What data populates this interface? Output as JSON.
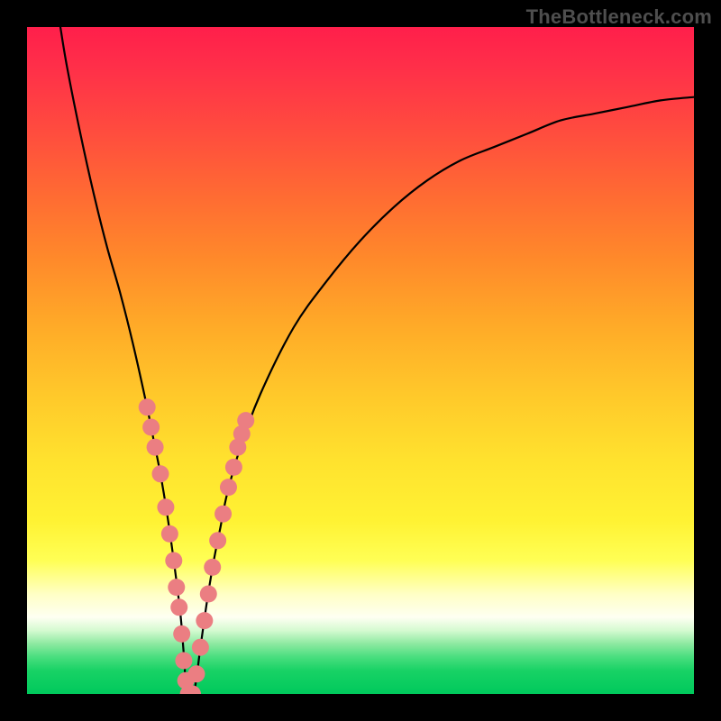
{
  "watermark": "TheBottleneck.com",
  "chart_data": {
    "type": "line",
    "title": "",
    "xlabel": "",
    "ylabel": "",
    "xlim": [
      0,
      100
    ],
    "ylim": [
      0,
      100
    ],
    "series": [
      {
        "name": "bottleneck-curve",
        "x": [
          5,
          6,
          8,
          10,
          12,
          14,
          16,
          18,
          19,
          20,
          21,
          22,
          23,
          23.5,
          24,
          25,
          26,
          27,
          28,
          29,
          30,
          32,
          35,
          40,
          45,
          50,
          55,
          60,
          65,
          70,
          75,
          80,
          85,
          90,
          95,
          100
        ],
        "values": [
          100,
          94,
          84,
          75,
          67,
          60,
          52,
          43,
          38,
          33,
          27,
          20,
          12,
          6,
          0,
          0,
          7,
          14,
          20,
          25,
          30,
          37,
          45,
          55,
          62,
          68,
          73,
          77,
          80,
          82,
          84,
          86,
          87,
          88,
          89,
          89.5
        ]
      }
    ],
    "highlight_points": {
      "name": "marked-range",
      "color": "#eb7e82",
      "points": [
        {
          "x": 18.0,
          "y": 43
        },
        {
          "x": 18.6,
          "y": 40
        },
        {
          "x": 19.2,
          "y": 37
        },
        {
          "x": 20.0,
          "y": 33
        },
        {
          "x": 20.8,
          "y": 28
        },
        {
          "x": 21.4,
          "y": 24
        },
        {
          "x": 22.0,
          "y": 20
        },
        {
          "x": 22.4,
          "y": 16
        },
        {
          "x": 22.8,
          "y": 13
        },
        {
          "x": 23.2,
          "y": 9
        },
        {
          "x": 23.5,
          "y": 5
        },
        {
          "x": 23.8,
          "y": 2
        },
        {
          "x": 24.2,
          "y": 0
        },
        {
          "x": 24.8,
          "y": 0
        },
        {
          "x": 25.4,
          "y": 3
        },
        {
          "x": 26.0,
          "y": 7
        },
        {
          "x": 26.6,
          "y": 11
        },
        {
          "x": 27.2,
          "y": 15
        },
        {
          "x": 27.8,
          "y": 19
        },
        {
          "x": 28.6,
          "y": 23
        },
        {
          "x": 29.4,
          "y": 27
        },
        {
          "x": 30.2,
          "y": 31
        },
        {
          "x": 31.0,
          "y": 34
        },
        {
          "x": 31.6,
          "y": 37
        },
        {
          "x": 32.2,
          "y": 39
        },
        {
          "x": 32.8,
          "y": 41
        }
      ]
    },
    "gradient_stops": [
      {
        "offset": 0.0,
        "color": "#ff1f4b"
      },
      {
        "offset": 0.06,
        "color": "#ff2f49"
      },
      {
        "offset": 0.15,
        "color": "#ff4a3f"
      },
      {
        "offset": 0.25,
        "color": "#ff6a33"
      },
      {
        "offset": 0.35,
        "color": "#ff8a2a"
      },
      {
        "offset": 0.45,
        "color": "#ffab28"
      },
      {
        "offset": 0.55,
        "color": "#ffc82a"
      },
      {
        "offset": 0.65,
        "color": "#ffe22e"
      },
      {
        "offset": 0.74,
        "color": "#fff233"
      },
      {
        "offset": 0.8,
        "color": "#ffff55"
      },
      {
        "offset": 0.85,
        "color": "#ffffc5"
      },
      {
        "offset": 0.885,
        "color": "#fefff2"
      },
      {
        "offset": 0.905,
        "color": "#d4fad0"
      },
      {
        "offset": 0.925,
        "color": "#8ce9a0"
      },
      {
        "offset": 0.945,
        "color": "#48de7e"
      },
      {
        "offset": 0.965,
        "color": "#18d265"
      },
      {
        "offset": 1.0,
        "color": "#00c95c"
      }
    ]
  }
}
